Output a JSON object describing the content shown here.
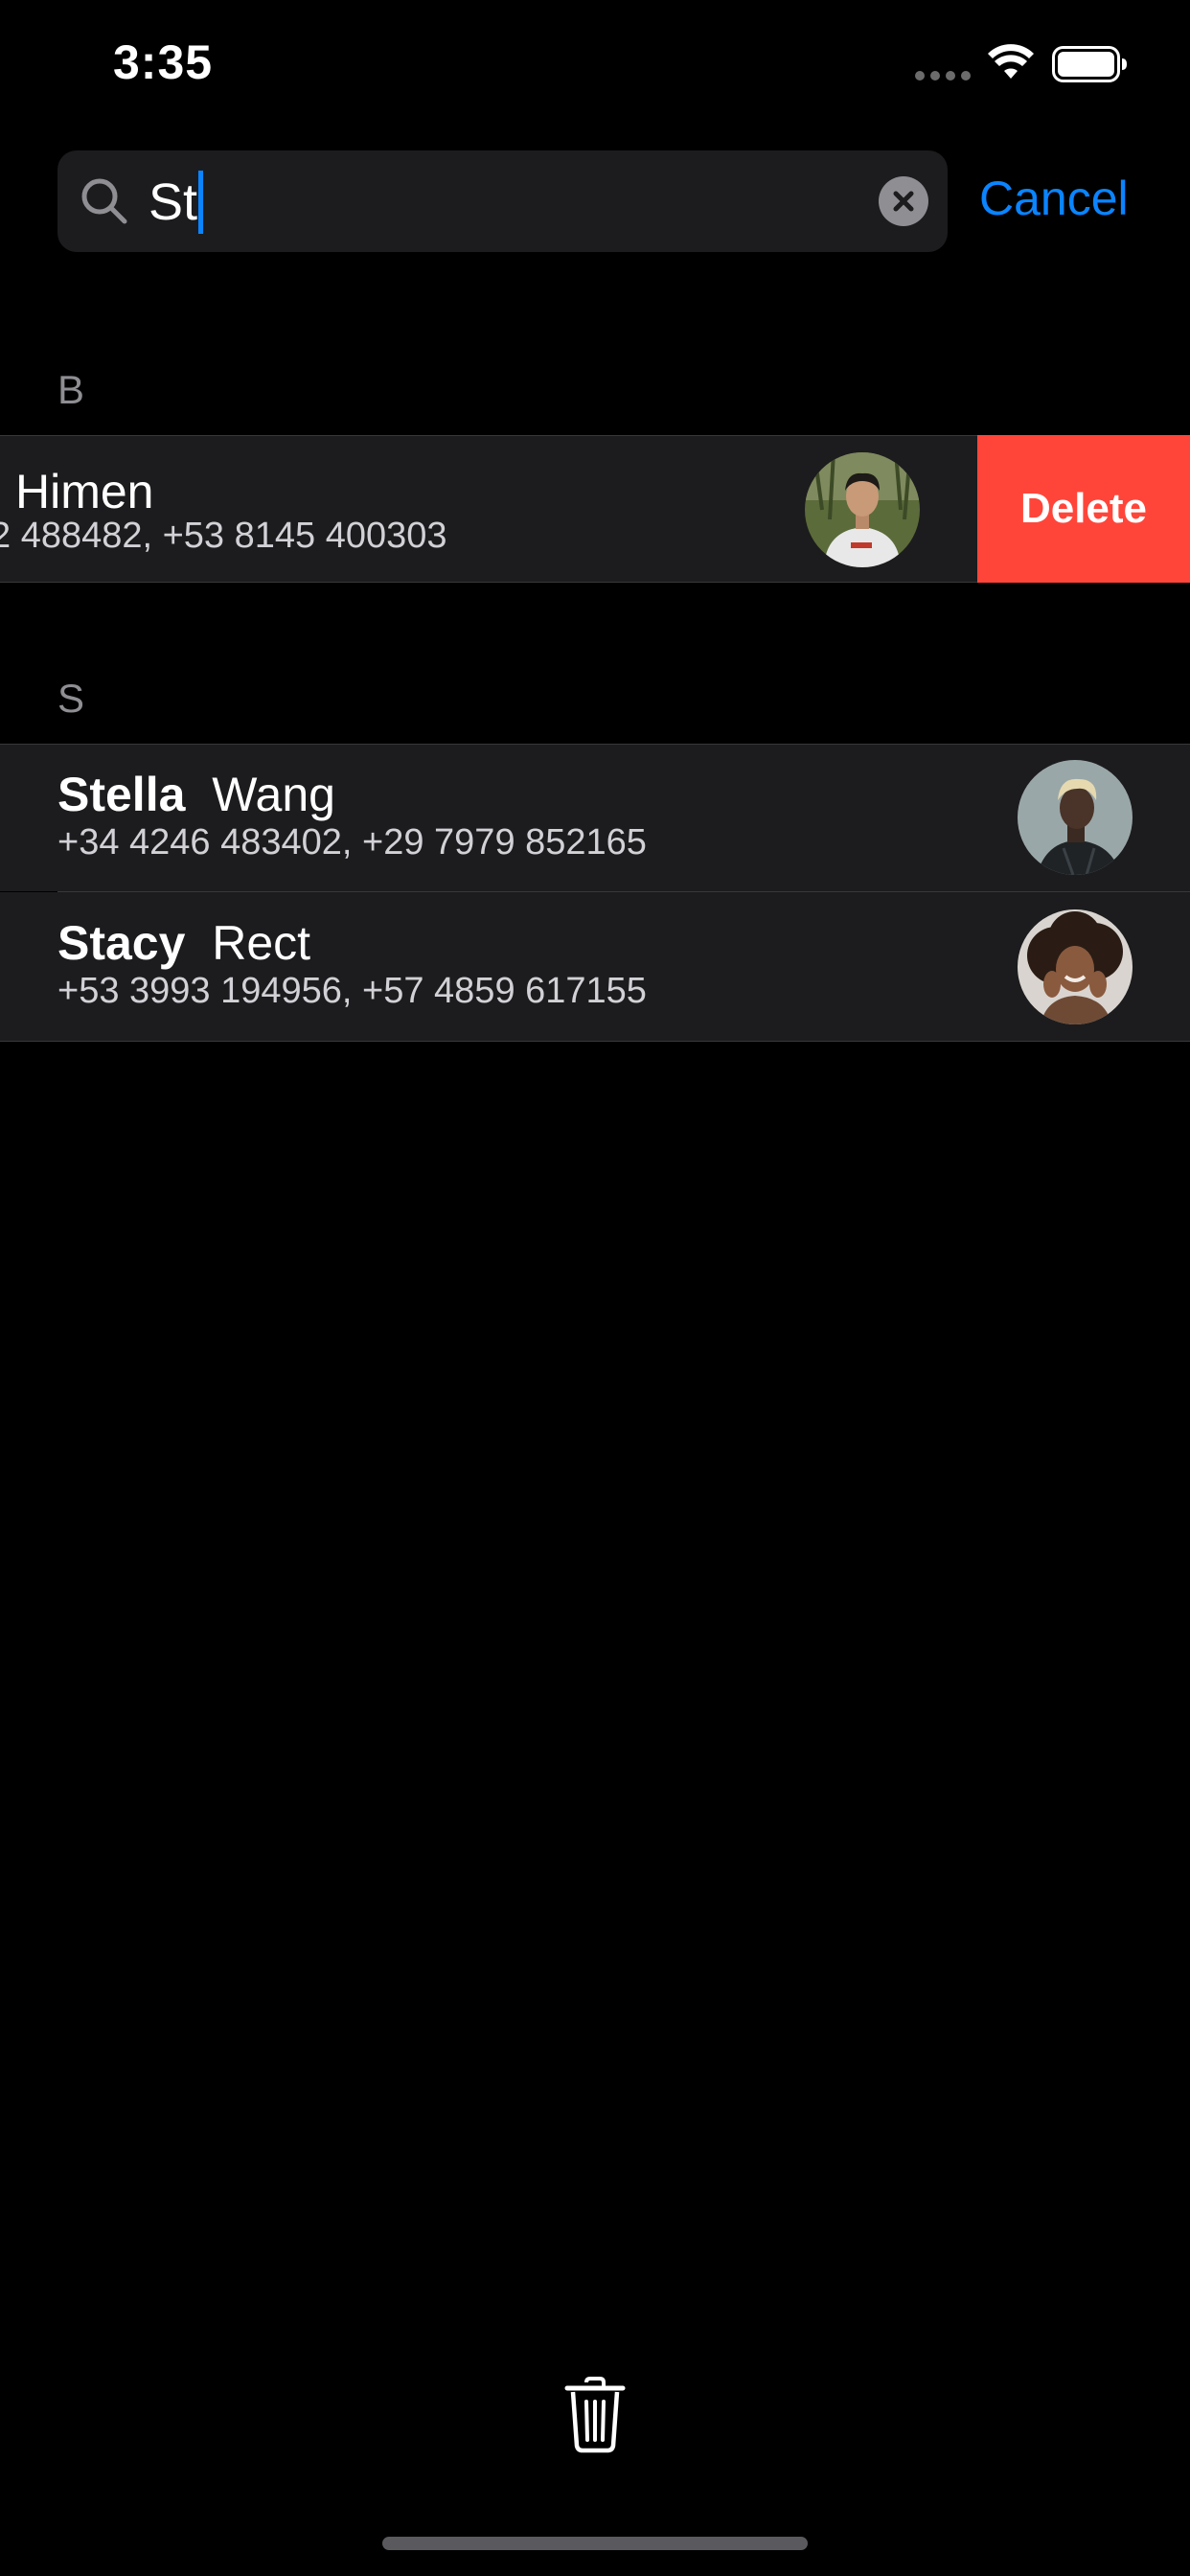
{
  "status_bar": {
    "time": "3:35",
    "wifi_icon": "wifi-icon",
    "battery_icon": "battery-icon"
  },
  "search": {
    "query": "St",
    "clear_icon": "clear-circle-icon",
    "search_icon": "magnifier-icon",
    "cancel_label": "Cancel"
  },
  "sections": [
    {
      "letter": "B",
      "contacts": [
        {
          "first_name": "",
          "last_name": "Himen",
          "phones": "2 488482, +53 8145 400303",
          "swiped": true,
          "delete_label": "Delete"
        }
      ]
    },
    {
      "letter": "S",
      "contacts": [
        {
          "first_name": "Stella",
          "last_name": "Wang",
          "phones": "+34 4246 483402, +29 7979 852165"
        },
        {
          "first_name": "Stacy",
          "last_name": "Rect",
          "phones": "+53 3993 194956, +57 4859 617155"
        }
      ]
    }
  ],
  "toolbar": {
    "trash_icon": "trash-icon"
  },
  "colors": {
    "background": "#000000",
    "row": "#1c1c1e",
    "accent": "#0a84ff",
    "delete": "#ff453a",
    "secondary_text": "#8e8e93"
  }
}
